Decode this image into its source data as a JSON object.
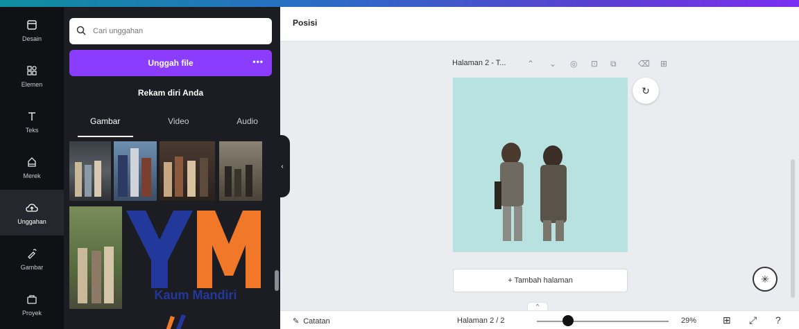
{
  "rail": {
    "items": [
      {
        "label": "Desain",
        "icon": "layout-icon"
      },
      {
        "label": "Elemen",
        "icon": "shapes-icon"
      },
      {
        "label": "Teks",
        "icon": "text-icon"
      },
      {
        "label": "Merek",
        "icon": "brand-icon"
      },
      {
        "label": "Unggahan",
        "icon": "cloud-upload-icon"
      },
      {
        "label": "Gambar",
        "icon": "draw-icon"
      },
      {
        "label": "Proyek",
        "icon": "folder-icon"
      }
    ],
    "active_index": 4
  },
  "panel": {
    "search_placeholder": "Cari unggahan",
    "upload_label": "Unggah file",
    "upload_more": "•••",
    "record_label": "Rekam diri Anda",
    "tabs": [
      "Gambar",
      "Video",
      "Audio"
    ],
    "logo_text": "YM",
    "logo_caption": "Kaum Mandiri"
  },
  "editor": {
    "position_label": "Posisi",
    "page_title": "Halaman 2 - T...",
    "add_page_label": "+ Tambah halaman"
  },
  "bottombar": {
    "notes_label": "Catatan",
    "page_indicator": "Halaman 2 / 2",
    "zoom": "29%"
  },
  "colors": {
    "accent": "#8b3dff",
    "panel_bg": "#1b1d22",
    "rail_bg": "#0f1115",
    "canvas_bg": "#b7e2e0"
  }
}
